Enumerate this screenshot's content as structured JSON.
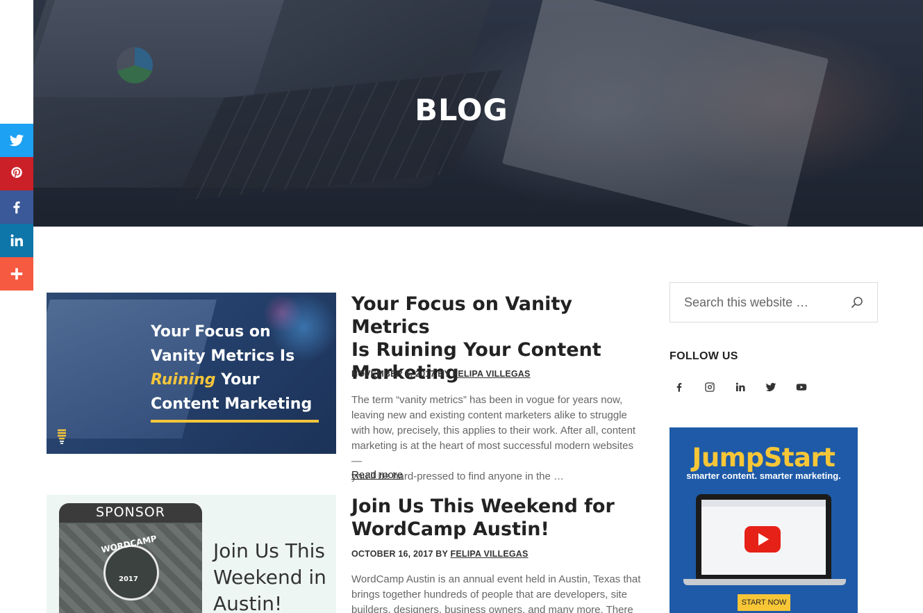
{
  "hero": {
    "title": "BLOG"
  },
  "share_bar": {
    "items": [
      {
        "name": "twitter",
        "icon": "twitter-icon",
        "color": "#1da1f2"
      },
      {
        "name": "pinterest",
        "icon": "pinterest-icon",
        "color": "#cb2027"
      },
      {
        "name": "facebook",
        "icon": "facebook-icon",
        "color": "#3b5998"
      },
      {
        "name": "linkedin",
        "icon": "linkedin-icon",
        "color": "#0e76a8"
      },
      {
        "name": "more",
        "icon": "plus-icon",
        "color": "#f65a41"
      }
    ]
  },
  "posts": [
    {
      "title_lines": [
        "Your Focus on Vanity Metrics",
        "Is Ruining Your Content",
        "Marketing"
      ],
      "date": "NOVEMBER 6, 2017",
      "by": "BY",
      "author": "FELIPA VILLEGAS",
      "excerpt_lines": [
        "The term “vanity metrics” has been in vogue for years now,",
        "leaving new and existing content marketers alike to struggle",
        "with how, precisely, this applies to their work. After all, content",
        "marketing is at the heart of most successful modern websites —",
        "you’ll be hard-pressed to find anyone in the …"
      ],
      "read_more": "Read more",
      "thumbnail": {
        "lines_before": [
          "Your Focus on",
          "Vanity Metrics Is"
        ],
        "highlight": "Ruining",
        "after_highlight": " Your",
        "last_line": "Content Marketing",
        "highlight_color": "#f5c53b"
      }
    },
    {
      "title_lines": [
        "Join Us This Weekend for",
        "WordCamp Austin!"
      ],
      "date": "OCTOBER 16, 2017",
      "by": "BY",
      "author": "FELIPA VILLEGAS",
      "excerpt_lines": [
        "WordCamp Austin is an annual event held in Austin, Texas that",
        "brings together hundreds of people that are developers, site",
        "builders, designers, business owners, and many more. There will"
      ],
      "thumbnail": {
        "badge_top": "SPONSOR",
        "badge_event": "WORDCAMP",
        "badge_year": "2017",
        "lines": [
          "Join Us This",
          "Weekend in",
          "Austin!"
        ]
      }
    }
  ],
  "sidebar": {
    "search_placeholder": "Search this website …",
    "follow_title": "FOLLOW US",
    "social_icons": [
      "facebook-icon",
      "instagram-icon",
      "linkedin-icon",
      "twitter-icon",
      "youtube-icon"
    ],
    "ad": {
      "title": "JumpStart",
      "subtitle": "smarter content. smarter marketing.",
      "button": "START NOW",
      "background": "#1e5aa8",
      "accent": "#f7c637"
    }
  }
}
